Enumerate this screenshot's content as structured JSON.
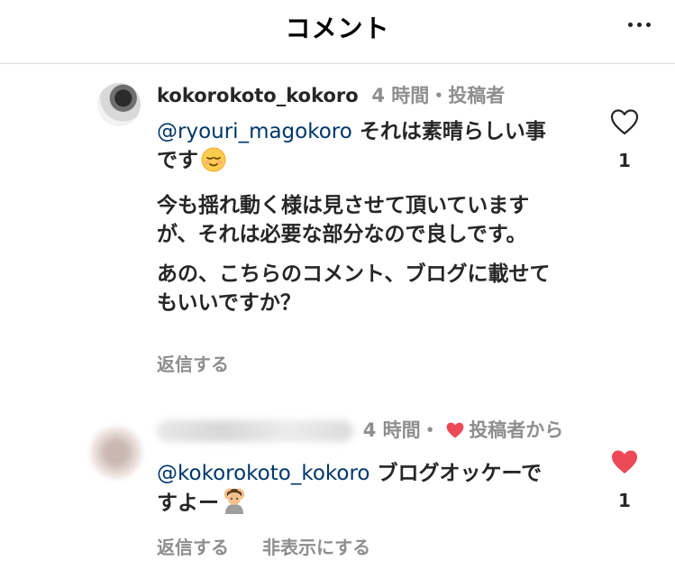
{
  "header": {
    "title": "コメント",
    "more_icon": "more-horizontal-icon"
  },
  "comments": [
    {
      "username": "kokorokoto_kokoro",
      "time": "4 時間",
      "separator": "・",
      "author_tag": "投稿者",
      "paragraphs": [
        {
          "mention": "@ryouri_magokoro",
          "text": " それは素晴らしい事です",
          "emoji": "relieved-face"
        },
        {
          "text": "今も揺れ動く様は見させて頂いていますが、それは必要な部分なので良しです。"
        },
        {
          "text": "あの、こちらのコメント、ブログに載せてもいいですか？"
        }
      ],
      "reply_label": "返信する",
      "like_count": "1",
      "liked": false
    },
    {
      "username_hidden": true,
      "time": "4 時間",
      "separator": "・",
      "author_tag": "投稿者から",
      "author_liked": true,
      "paragraphs": [
        {
          "mention": "@kokorokoto_kokoro",
          "text": " ブログオッケーですよー",
          "emoji": "person-gesturing-ok"
        }
      ],
      "reply_label": "返信する",
      "hide_label": "非表示にする",
      "like_count": "1",
      "liked": true
    }
  ],
  "colors": {
    "like_red": "#ed4956",
    "mention_blue": "#00376b",
    "meta_gray": "#8e8e8e"
  }
}
